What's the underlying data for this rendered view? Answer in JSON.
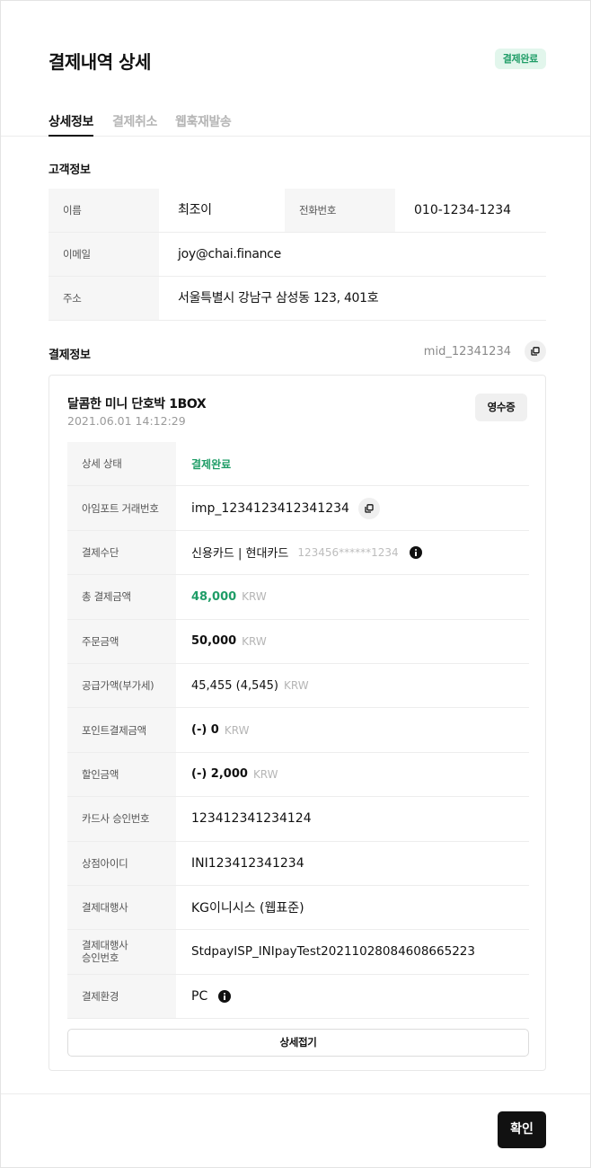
{
  "header": {
    "title": "결제내역 상세",
    "status_badge": "결제완료"
  },
  "tabs": [
    {
      "label": "상세정보",
      "active": true
    },
    {
      "label": "결제취소",
      "active": false
    },
    {
      "label": "웹훅재발송",
      "active": false
    }
  ],
  "customer": {
    "section_title": "고객정보",
    "name_label": "이름",
    "name": "최조이",
    "phone_label": "전화번호",
    "phone": "010-1234-1234",
    "email_label": "이메일",
    "email": "joy@chai.finance",
    "address_label": "주소",
    "address": "서울특별시 강남구 삼성동 123, 401호"
  },
  "payment": {
    "section_title": "결제정보",
    "mid": "mid_12341234",
    "product_name": "달콤한 미니 단호박 1BOX",
    "date": "2021.06.01 14:12:29",
    "receipt_label": "영수증",
    "unit": "KRW",
    "rows": {
      "status": {
        "label": "상세 상태",
        "value": "결제완료"
      },
      "imp_uid": {
        "label": "아임포트 거래번호",
        "value": "imp_1234123412341234"
      },
      "method": {
        "label": "결제수단",
        "value": "신용카드 | 현대카드",
        "card_number": "123456******1234"
      },
      "total": {
        "label": "총 결제금액",
        "value": "48,000"
      },
      "order": {
        "label": "주문금액",
        "value": "50,000"
      },
      "supply": {
        "label": "공급가액(부가세)",
        "value": "45,455 (4,545)"
      },
      "point": {
        "label": "포인트결제금액",
        "value": "(-) 0"
      },
      "discount": {
        "label": "할인금액",
        "value": "(-) 2,000"
      },
      "card_approval": {
        "label": "카드사 승인번호",
        "value": "123412341234124"
      },
      "merchant_id": {
        "label": "상점아이디",
        "value": "INI123412341234"
      },
      "pg": {
        "label": "결제대행사",
        "value": "KG이니시스 (웹표준)"
      },
      "pg_approval": {
        "label_line1": "결제대행사",
        "label_line2": "승인번호",
        "value": "StdpayISP_INIpayTest20211028084608665223"
      },
      "env": {
        "label": "결제환경",
        "value": "PC"
      }
    },
    "collapse_label": "상세접기"
  },
  "footer": {
    "confirm_label": "확인"
  },
  "colors": {
    "accent_green": "#1f9d67",
    "badge_bg": "#e2f6ec",
    "primary_button": "#111111"
  }
}
